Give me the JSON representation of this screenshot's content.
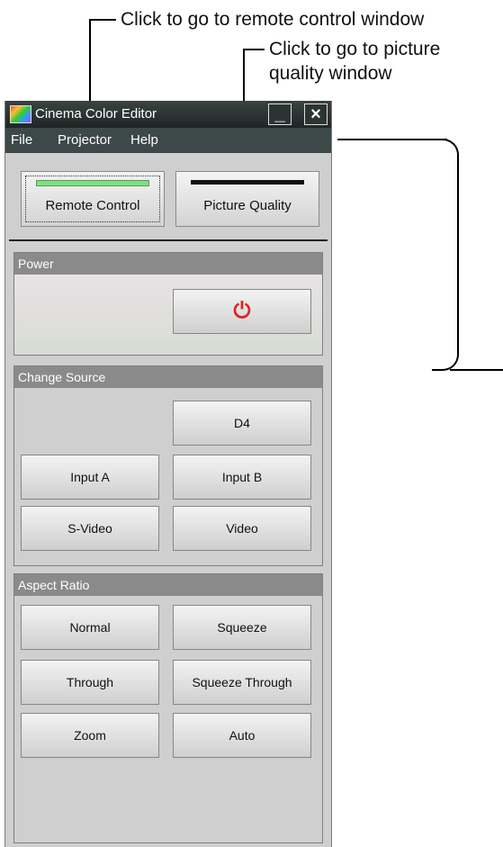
{
  "callouts": {
    "remote": "Click to go to remote control window",
    "picture_line1": "Click to go to picture",
    "picture_line2": "quality window"
  },
  "window": {
    "title": "Cinema Color Editor",
    "minimize": "_",
    "close": "×",
    "menu": [
      "File",
      "Projector",
      "Help"
    ]
  },
  "top_buttons": {
    "remote": "Remote Control",
    "picture": "Picture Quality"
  },
  "colors": {
    "remote_bar": "#7fe07f",
    "picture_bar": "#111111",
    "power_icon": "#e02222"
  },
  "power": {
    "title": "Power",
    "button_icon": "power-symbol"
  },
  "change_source": {
    "title": "Change Source",
    "buttons": [
      "D4",
      "Input A",
      "Input B",
      "S-Video",
      "Video"
    ]
  },
  "aspect_ratio": {
    "title": "Aspect Ratio",
    "buttons": [
      "Normal",
      "Squeeze",
      "Through",
      "Squeeze Through",
      "Zoom",
      "Auto"
    ]
  }
}
